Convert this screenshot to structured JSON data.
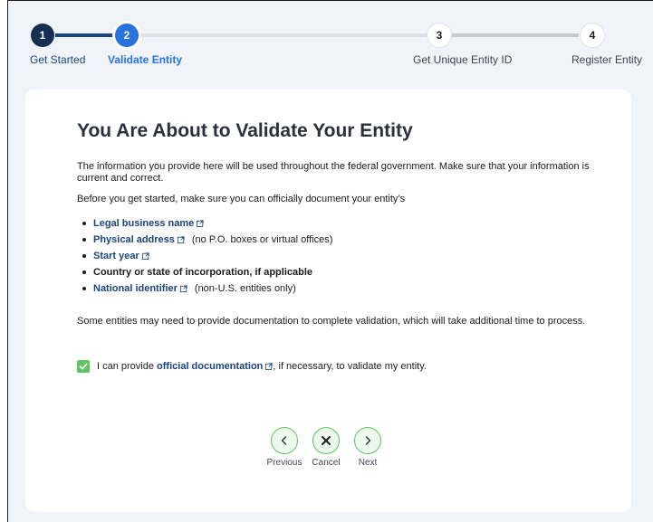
{
  "stepper": {
    "steps": [
      {
        "number": "1",
        "label": "Get Started",
        "state": "complete"
      },
      {
        "number": "2",
        "label": "Validate Entity",
        "state": "current"
      },
      {
        "number": "3",
        "label": "Get Unique Entity ID",
        "state": "upcoming"
      },
      {
        "number": "4",
        "label": "Register Entity",
        "state": "upcoming"
      }
    ]
  },
  "card": {
    "title": "You Are About to Validate Your Entity",
    "intro": "The information you provide here will be used throughout the federal government. Make sure that your information is current and correct.",
    "before": "Before you get started, make sure you can officially document your entity’s",
    "items": [
      {
        "label": "Legal business name",
        "link": true,
        "note": ""
      },
      {
        "label": "Physical address",
        "link": true,
        "note": "(no P.O. boxes or virtual offices)"
      },
      {
        "label": "Start year",
        "link": true,
        "note": ""
      },
      {
        "label": "Country or state of incorporation, if applicable",
        "link": false,
        "note": ""
      },
      {
        "label": "National identifier",
        "link": true,
        "note": "(non-U.S. entities only)"
      }
    ],
    "some_entities": "Some entities may need to provide documentation to complete validation, which will take additional time to process.",
    "agree": {
      "prefix": "I can provide",
      "link": "official documentation",
      "suffix": ", if necessary, to validate my entity.",
      "checked": true
    }
  },
  "nav": {
    "previous": "Previous",
    "cancel": "Cancel",
    "next": "Next"
  },
  "colors": {
    "primary_dark": "#162e51",
    "primary": "#2672de",
    "link": "#1a4480",
    "success": "#5dc661",
    "background": "#f0f4f9"
  },
  "icons": {
    "external_link": "external-link-icon",
    "check": "check-icon",
    "previous": "chevron-left-icon",
    "cancel": "close-icon",
    "next": "chevron-right-icon"
  }
}
